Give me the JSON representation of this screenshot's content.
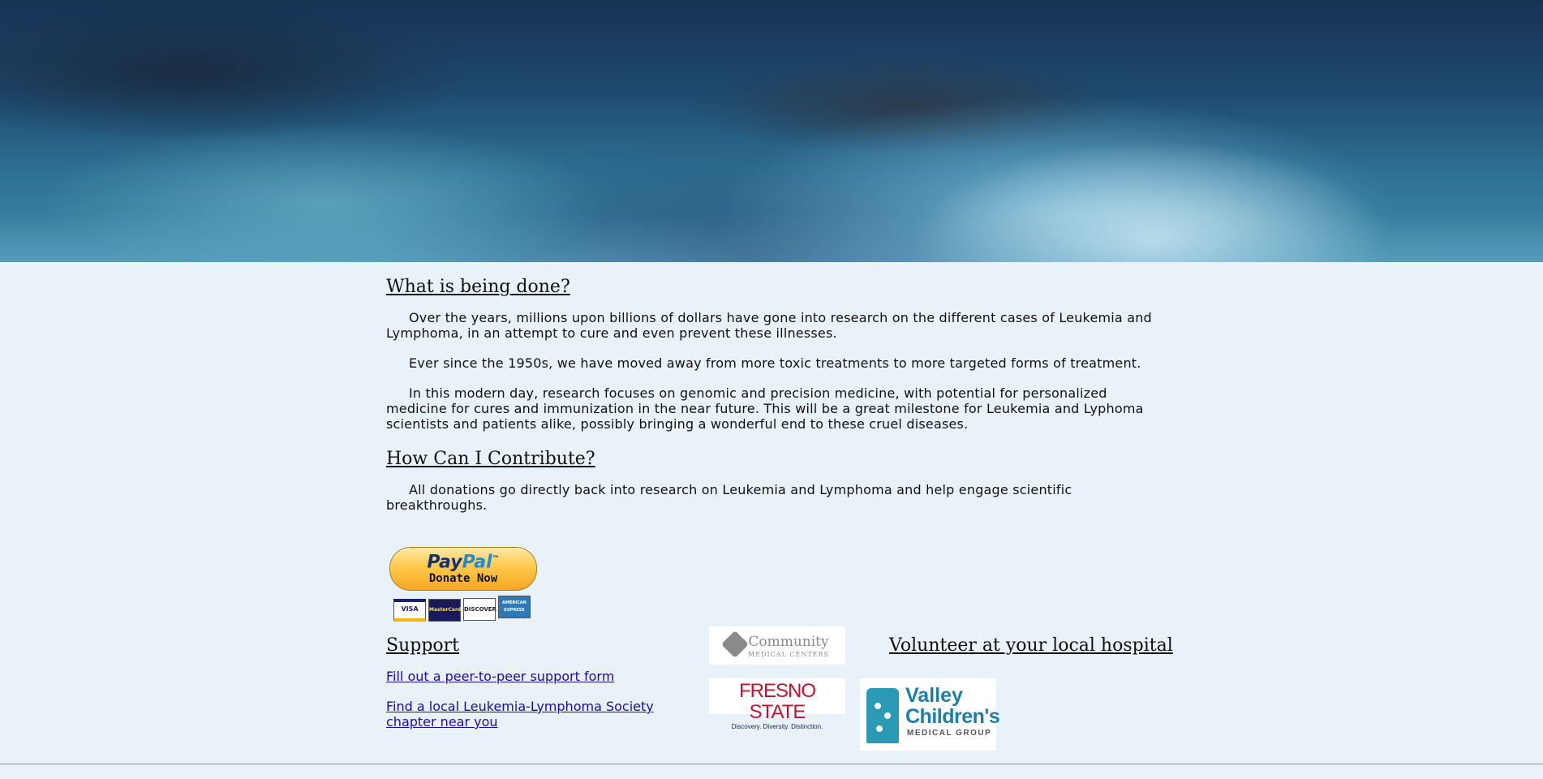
{
  "sections": {
    "what": {
      "title": "What is being done?",
      "p1": "Over the years, millions upon billions of dollars have gone into research on the different cases of Leukemia and Lymphoma, in an attempt to cure and even prevent these illnesses.",
      "p2": "Ever since the 1950s, we have moved away from more toxic treatments to more targeted forms of treatment.",
      "p3": "In this modern day, research focuses on genomic and precision medicine, with potential for personalized medicine for cures and immunization in the near future. This will be a great milestone for Leukemia and Lyphoma scientists and patients alike, possibly bringing a wonderful end to these cruel diseases."
    },
    "contribute": {
      "title": "How Can I Contribute?",
      "p1": "All donations go directly back into research on Leukemia and Lymphoma and help engage scientific breakthroughs."
    }
  },
  "paypal": {
    "logo_pay": "Pay",
    "logo_pal": "Pal",
    "logo_tm": "™",
    "donate_label": "Donate Now",
    "cards": [
      "VISA",
      "MasterCard",
      "DISCOVER",
      "AMERICAN EXPRESS"
    ]
  },
  "support": {
    "title": "Support",
    "link1": "Fill out a peer-to-peer support form",
    "link2": "Find a local Leukemia-Lymphoma Society chapter near you"
  },
  "volunteer": {
    "title": "Volunteer at your local hospital"
  },
  "logos": {
    "cmc_name": "Community",
    "cmc_sub": "MEDICAL CENTERS",
    "fs_name": "FRESNO STATE",
    "fs_tag": "Discovery. Diversity. Distinction.",
    "vc_line1": "Valley",
    "vc_line2": "Children's",
    "vc_line3": "MEDICAL GROUP"
  },
  "colors": {
    "page_bg": "#e9f1f9",
    "link": "#1a0dab",
    "paypal_gold": "#ffc94b"
  }
}
